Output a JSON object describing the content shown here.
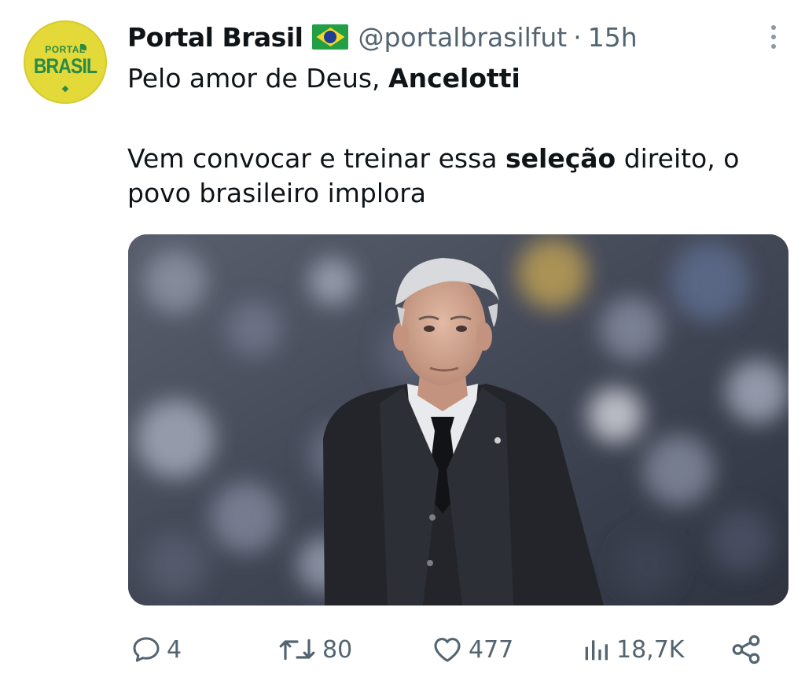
{
  "tweet": {
    "display_name": "Portal Brasil",
    "handle": "@portalbrasilfut",
    "separator": "·",
    "time": "15h",
    "text_line1_prefix": "Pelo amor de Deus, ",
    "text_line1_bold": "Ancelotti",
    "text_line2_prefix": "Vem convocar e treinar essa ",
    "text_line2_bold": "seleção",
    "text_line2_suffix": " direito, o povo brasileiro implora"
  },
  "avatar": {
    "logo_top": "PORTAL",
    "logo_main": "BRASIL"
  },
  "actions": {
    "replies": "4",
    "reposts": "80",
    "likes": "477",
    "views": "18,7K"
  },
  "icons": {
    "reply": "reply-icon",
    "repost": "repost-icon",
    "like": "heart-icon",
    "views": "views-icon",
    "share": "share-icon",
    "more": "more-vertical-icon",
    "flag": "brazil-flag-icon"
  },
  "colors": {
    "text": "#0f1419",
    "secondary": "#536471",
    "avatar_bg": "#e3da3a",
    "avatar_fg": "#2a8a47"
  }
}
